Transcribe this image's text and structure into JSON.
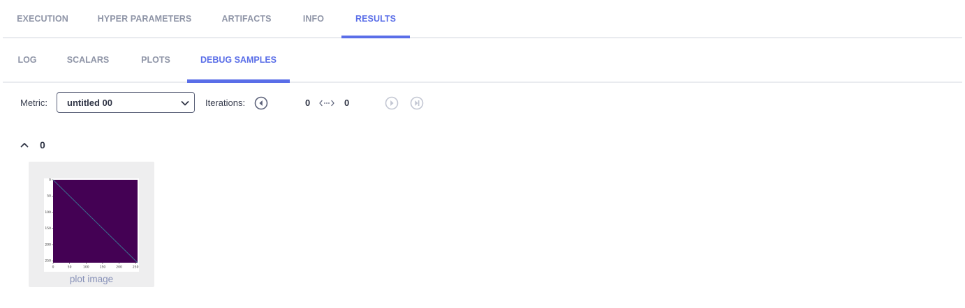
{
  "tabs_top": [
    {
      "label": "EXECUTION",
      "active": false
    },
    {
      "label": "HYPER PARAMETERS",
      "active": false
    },
    {
      "label": "ARTIFACTS",
      "active": false
    },
    {
      "label": "INFO",
      "active": false
    },
    {
      "label": "RESULTS",
      "active": true
    }
  ],
  "tabs_sub": [
    {
      "label": "LOG",
      "active": false
    },
    {
      "label": "SCALARS",
      "active": false
    },
    {
      "label": "PLOTS",
      "active": false
    },
    {
      "label": "DEBUG SAMPLES",
      "active": true
    }
  ],
  "toolbar": {
    "metric_label": "Metric:",
    "metric_value": "untitled 00",
    "iterations_label": "Iterations:",
    "iteration_from": "0",
    "iteration_to": "0"
  },
  "group": {
    "title": "0",
    "samples": [
      {
        "caption": "plot image",
        "thumbnail": {
          "y_ticks": [
            "0",
            "50",
            "100",
            "150",
            "200",
            "250"
          ],
          "x_ticks": [
            "0",
            "50",
            "100",
            "150",
            "200",
            "250"
          ]
        }
      }
    ]
  },
  "colors": {
    "accent": "#5a6ee8",
    "tab_inactive": "#8f95a7",
    "text_dark": "#2f3445",
    "image_fill": "#440154",
    "caption": "#8791b8"
  },
  "icons": {
    "select_arrow": "chevron-down-icon",
    "prev": "circle-arrow-left-icon",
    "range": "double-arrow-dotted-icon",
    "next": "circle-arrow-right-icon",
    "last": "circle-skip-end-icon",
    "collapse": "chevron-up-icon"
  }
}
